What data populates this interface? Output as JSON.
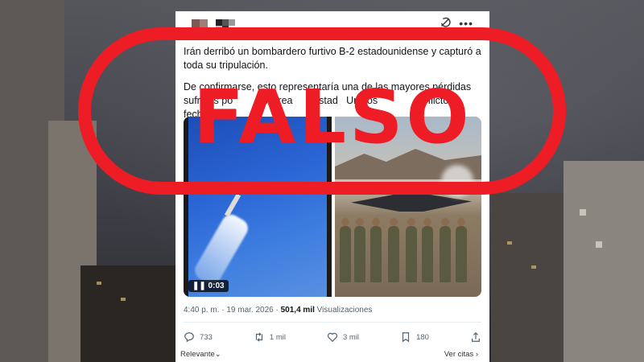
{
  "tweet": {
    "paragraph1": "Irán derribó un bombardero furtivo B-2 estadounidense y capturó a toda su tripulación.",
    "paragraph2": "De confirmarse, esto representaría una de las mayores pérdidas sufridas po         a Aérea       Estad   Unidos                  flicto       fecha.",
    "video_time": "0:03",
    "timestamp": "4:40 p. m. · 19 mar. 2026 · ",
    "views_count": "501,4 mil",
    "views_label": "Visualizaciones",
    "replies": "733",
    "reposts": "1 mil",
    "likes": "3 mil",
    "bookmarks": "180",
    "relevance_label": "Relevante",
    "quotes_label": "Ver citas"
  },
  "stamp": {
    "text": "FALSO",
    "color": "#ee1c25"
  },
  "icons": [
    "grok-icon",
    "more-icon",
    "reply-icon",
    "repost-icon",
    "like-icon",
    "bookmark-icon",
    "share-icon",
    "chevron-down-icon",
    "chevron-right-icon",
    "play-icon"
  ]
}
